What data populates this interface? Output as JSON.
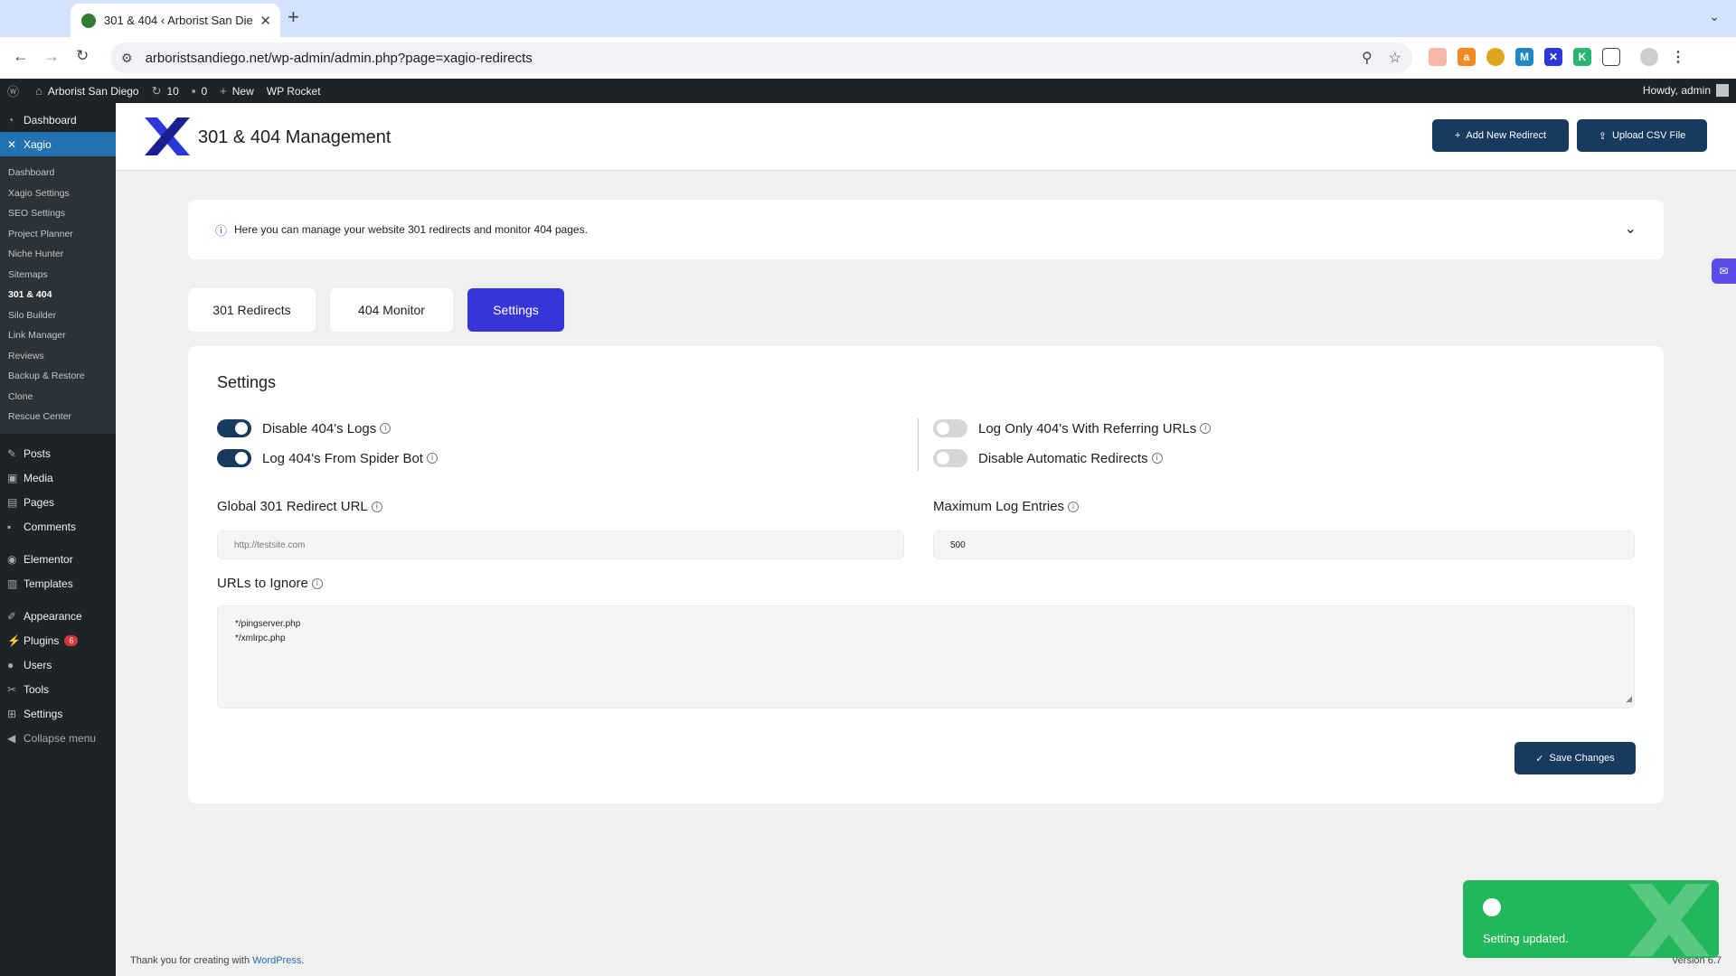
{
  "browser": {
    "tab_title": "301 & 404 ‹ Arborist San Die",
    "url": "arboristsandiego.net/wp-admin/admin.php?page=xagio-redirects"
  },
  "adminbar": {
    "site_name": "Arborist San Diego",
    "updates_count": "10",
    "comments_count": "0",
    "new_label": "New",
    "wp_rocket_label": "WP Rocket",
    "howdy": "Howdy, admin"
  },
  "sidebar": {
    "dashboard": "Dashboard",
    "xagio": "Xagio",
    "submenu": [
      "Dashboard",
      "Xagio Settings",
      "SEO Settings",
      "Project Planner",
      "Niche Hunter",
      "Sitemaps",
      "301 & 404",
      "Silo Builder",
      "Link Manager",
      "Reviews",
      "Backup & Restore",
      "Clone",
      "Rescue Center"
    ],
    "posts": "Posts",
    "media": "Media",
    "pages": "Pages",
    "comments": "Comments",
    "elementor": "Elementor",
    "templates": "Templates",
    "appearance": "Appearance",
    "plugins": "Plugins",
    "plugins_badge": "6",
    "users": "Users",
    "tools": "Tools",
    "settings": "Settings",
    "collapse": "Collapse menu"
  },
  "header": {
    "title": "301 & 404 Management",
    "add_redirect": "Add New Redirect",
    "upload_csv": "Upload CSV File"
  },
  "notice": {
    "text": "Here you can manage your website 301 redirects and monitor 404 pages."
  },
  "tabs": [
    "301 Redirects",
    "404 Monitor",
    "Settings"
  ],
  "settings": {
    "title": "Settings",
    "toggles": {
      "disable_404_logs": {
        "label": "Disable 404's Logs",
        "on": true
      },
      "log_spider_bot": {
        "label": "Log 404's From Spider Bot",
        "on": true
      },
      "log_referring": {
        "label": "Log Only 404's With Referring URLs",
        "on": false
      },
      "disable_auto_redirects": {
        "label": "Disable Automatic Redirects",
        "on": false
      }
    },
    "global_redirect_label": "Global 301 Redirect URL",
    "global_redirect_placeholder": "http://testsite.com",
    "max_log_label": "Maximum Log Entries",
    "max_log_value": "500",
    "ignore_label": "URLs to Ignore",
    "ignore_value": "*/pingserver.php\n*/xmlrpc.php",
    "save_label": "Save Changes"
  },
  "footer": {
    "thanks": "Thank you for creating with ",
    "wp_link": "WordPress",
    "period": ".",
    "version": "Version 6.7"
  },
  "toast": {
    "message": "Setting updated."
  }
}
